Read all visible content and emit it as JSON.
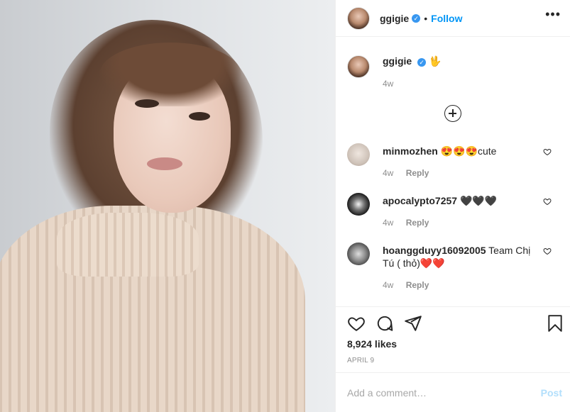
{
  "post": {
    "owner": "ggigie",
    "follow_label": "Follow",
    "dot": "•",
    "more_glyph": "•••",
    "caption_emoji": "🖖",
    "caption_time": "4w",
    "likes": "8,924 likes",
    "date": "APRIL 9"
  },
  "comments": [
    {
      "username": "minmozhen",
      "text": "😍😍😍cute",
      "time": "4w",
      "reply_label": "Reply"
    },
    {
      "username": "apocalypto7257",
      "text": "🖤🖤🖤",
      "time": "4w",
      "reply_label": "Reply"
    },
    {
      "username": "hoanggduyy16092005",
      "text": "Team Chị Tú ( thỏ)❤️❤️",
      "time": "4w",
      "reply_label": "Reply"
    }
  ],
  "comment_box": {
    "placeholder": "Add a comment…",
    "post_label": "Post"
  },
  "icons": {
    "verified": "verified-badge-icon",
    "more": "more-options-icon",
    "load_more": "load-more-comments-icon",
    "like": "heart-icon",
    "comment": "comment-icon",
    "share": "share-icon",
    "save": "bookmark-icon"
  },
  "colors": {
    "link_blue": "#0095f6",
    "verified_blue": "#3897f0",
    "muted": "#8e8e8e",
    "post_disabled": "#b2dffc"
  }
}
